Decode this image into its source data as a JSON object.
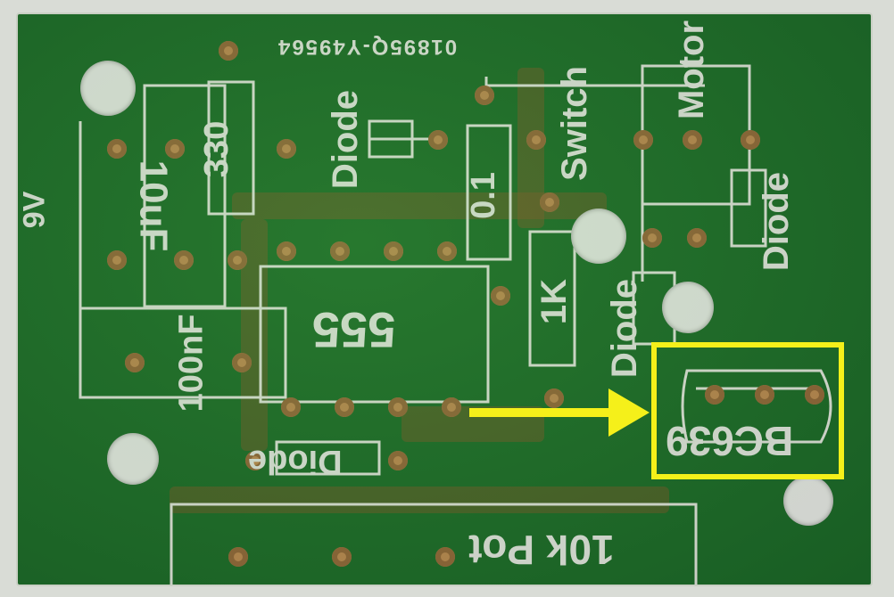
{
  "board": {
    "serial": "01895Q-Y49564",
    "labels": {
      "nine_volt": "9V",
      "resistor_330": "330",
      "cap_10uf": "10uF",
      "diode_top": "Diode",
      "switch": "Switch",
      "motor": "Motor",
      "diode_right": "Diode",
      "cap_100nf": "100nF",
      "ic_555": "555",
      "resistor_1k": "1K",
      "diode_mid": "Diode",
      "transistor": "BC639",
      "diode_bottom": "Diode",
      "pot": "10k Pot",
      "resistor_01": "0.1"
    }
  },
  "annotation": {
    "highlight_color": "#f5f01a",
    "target": "transistor"
  }
}
